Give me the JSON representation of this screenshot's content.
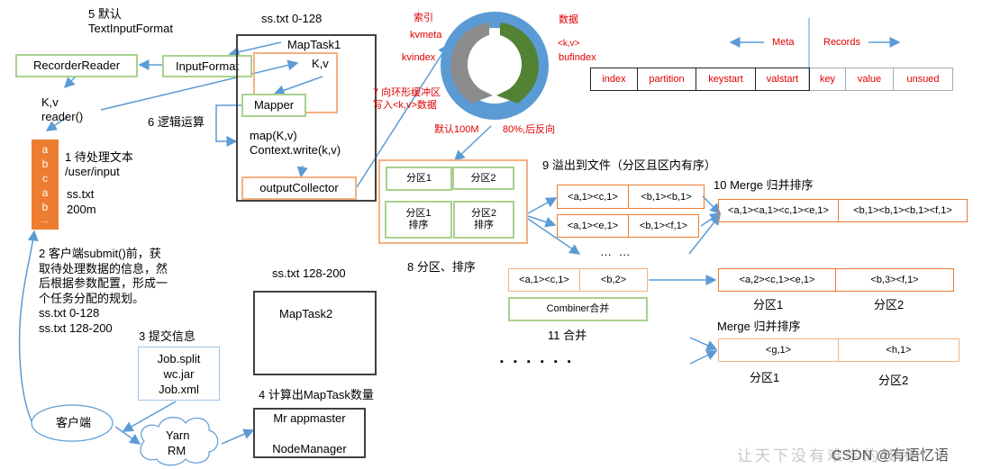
{
  "labels": {
    "step5": "5 默认",
    "step5_sub": "TextInputFormat",
    "recorder_reader": "RecorderReader",
    "input_format": "InputFormat",
    "kv_reader_1": "K,v",
    "kv_reader_2": "reader()",
    "step6": "6 逻辑运算",
    "step1_title": "1 待处理文本",
    "step1_path": "/user/input",
    "step1_file": "ss.txt",
    "step1_size": "200m",
    "step2_lines": [
      "2 客户端submit()前，获",
      "取待处理数据的信息，然",
      "后根据参数配置，形成一",
      "个任务分配的规划。",
      "ss.txt  0-128",
      "ss.txt  128-200"
    ],
    "step3": "3 提交信息",
    "step4": "4 计算出MapTask数量",
    "client": "客户端",
    "yarn_1": "Yarn",
    "yarn_2": "RM",
    "mr_appmaster": "Mr appmaster",
    "node_manager": "NodeManager"
  },
  "text_block": [
    "a",
    "b",
    "c",
    "a",
    "b",
    "…"
  ],
  "job_files": [
    "Job.split",
    "wc.jar",
    "Job.xml"
  ],
  "maptask1": {
    "split_label": "ss.txt 0-128",
    "title": "MapTask1",
    "kv": "K,v",
    "mapper": "Mapper",
    "map_call": "map(K,v)",
    "context_write": "Context.write(k,v)",
    "output_collector": "outputCollector"
  },
  "maptask2": {
    "split_label": "ss.txt 128-200",
    "title": "MapTask2"
  },
  "ring_buffer": {
    "index_label": "索引",
    "kvmeta": "kvmeta",
    "kvindex": "kvindex",
    "data_label": "数据",
    "kv": "<k,v>",
    "bufindex": "bufindex",
    "step7_1": "7 向环形缓冲区",
    "step7_2": "写入<k,v>数据",
    "default_size": "默认100M",
    "threshold": "80%,后反向",
    "colors": {
      "ring": "#5b9bd5",
      "meta_arrow": "#808080",
      "data_arrow": "#548235"
    }
  },
  "buffer_layout": {
    "meta_label": "Meta",
    "records_label": "Records",
    "meta_cells": [
      "index",
      "partition",
      "keystart",
      "valstart"
    ],
    "record_cells": [
      "key",
      "value",
      "unsued"
    ]
  },
  "partition_box": {
    "p1": "分区1",
    "p2": "分区2",
    "p1_sort_1": "分区1",
    "p1_sort_2": "排序",
    "p2_sort_1": "分区2",
    "p2_sort_2": "排序",
    "step8": "8 分区、排序"
  },
  "spill": {
    "step9": "9 溢出到文件（分区且区内有序）",
    "files": [
      [
        "<a,1><c,1>",
        "<b,1><b,1>"
      ],
      [
        "<a,1><e,1>",
        "<b,1><f,1>"
      ]
    ],
    "ellipsis": "…  …"
  },
  "merge": {
    "step10": "10 Merge 归并排序",
    "cells": [
      "<a,1><a,1><c,1><e,1>",
      "<b,1><b,1><b,1><f,1>"
    ]
  },
  "combiner": {
    "cells": [
      "<a,1><c,1>",
      "<b,2>"
    ],
    "label": "Combiner合并",
    "step11": "11 合并",
    "result_cells": [
      "<a,2><c,1><e,1>",
      "<b,3><f,1>"
    ],
    "p1": "分区1",
    "p2": "分区2"
  },
  "merge2": {
    "label": "Merge 归并排序",
    "cells": [
      "<g,1>",
      "<h,1>"
    ],
    "p1": "分区1",
    "p2": "分区2"
  },
  "dots": "▪ ▪ ▪   ▪ ▪ ▪",
  "watermark": {
    "faded": "让天下没有难学的技术",
    "credit": "CSDN @有语忆语"
  },
  "colors": {
    "arrow": "#5b9bd5",
    "green_border": "#a9d18e",
    "orange_border": "#f4b183",
    "orange_fill": "#ed7d31",
    "red_text": "#e00000"
  }
}
